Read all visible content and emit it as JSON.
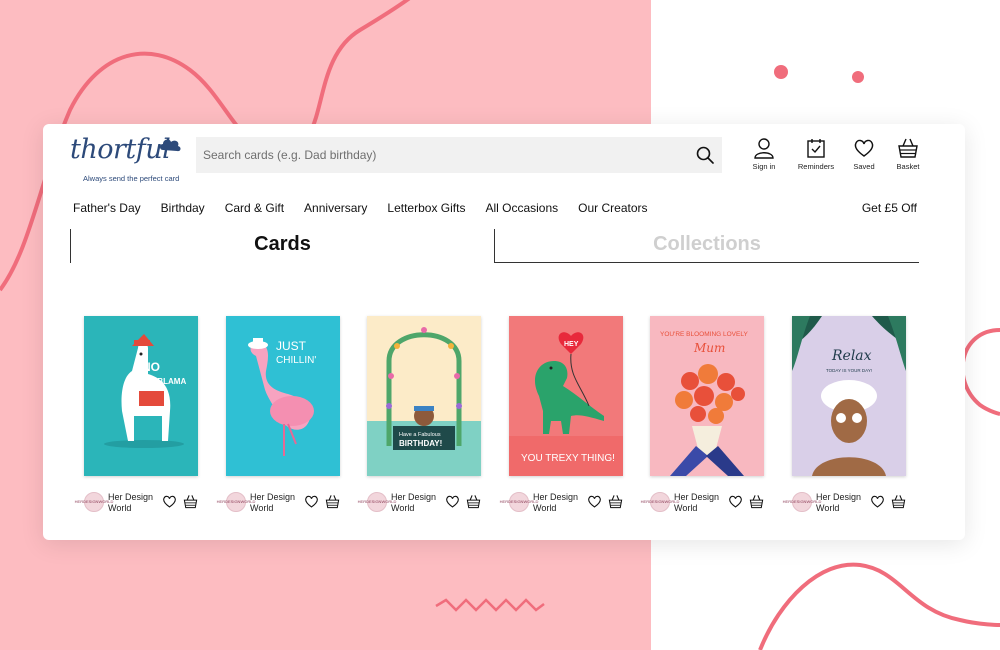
{
  "brand": {
    "logo_text": "thortful",
    "tagline": "Always send the perfect card",
    "color": "#2d4a7a"
  },
  "search": {
    "placeholder": "Search cards (e.g. Dad birthday)"
  },
  "actions": [
    {
      "label": "Sign in",
      "icon": "user-icon"
    },
    {
      "label": "Reminders",
      "icon": "calendar-check-icon"
    },
    {
      "label": "Saved",
      "icon": "heart-icon"
    },
    {
      "label": "Basket",
      "icon": "basket-icon"
    }
  ],
  "nav": {
    "items": [
      "Father's Day",
      "Birthday",
      "Card & Gift",
      "Anniversary",
      "Letterbox Gifts",
      "All Occasions",
      "Our Creators"
    ],
    "promo": "Get £5 Off"
  },
  "tabs": {
    "cards": "Cards",
    "collections": "Collections"
  },
  "products": [
    {
      "creator": "Her Design World",
      "art_text": [
        "NO",
        "PROBLAMA"
      ],
      "bg": "#2bb5b9"
    },
    {
      "creator": "Her Design World",
      "art_text": [
        "JUST",
        "CHILLIN'"
      ],
      "bg": "#2fc0d4"
    },
    {
      "creator": "Her Design World",
      "art_text": [
        "Have a Fabulous",
        "BIRTHDAY!"
      ],
      "bg": "#fcebc8"
    },
    {
      "creator": "Her Design World",
      "art_text": [
        "HEY",
        "YOU TREXY THING!"
      ],
      "bg": "#f2797a"
    },
    {
      "creator": "Her Design World",
      "art_text": [
        "YOU'RE BLOOMING LOVELY",
        "Mum"
      ],
      "bg": "#f8b8c0"
    },
    {
      "creator": "Her Design World",
      "art_text": [
        "Relax",
        "TODAY IS YOUR DAY!"
      ],
      "bg": "#d9cfe8"
    }
  ],
  "avatar_text": [
    "HER",
    "DESIGN",
    "WORLD"
  ],
  "colors": {
    "background_pink": "#fdbcc1",
    "accent_coral": "#f06d7c"
  }
}
